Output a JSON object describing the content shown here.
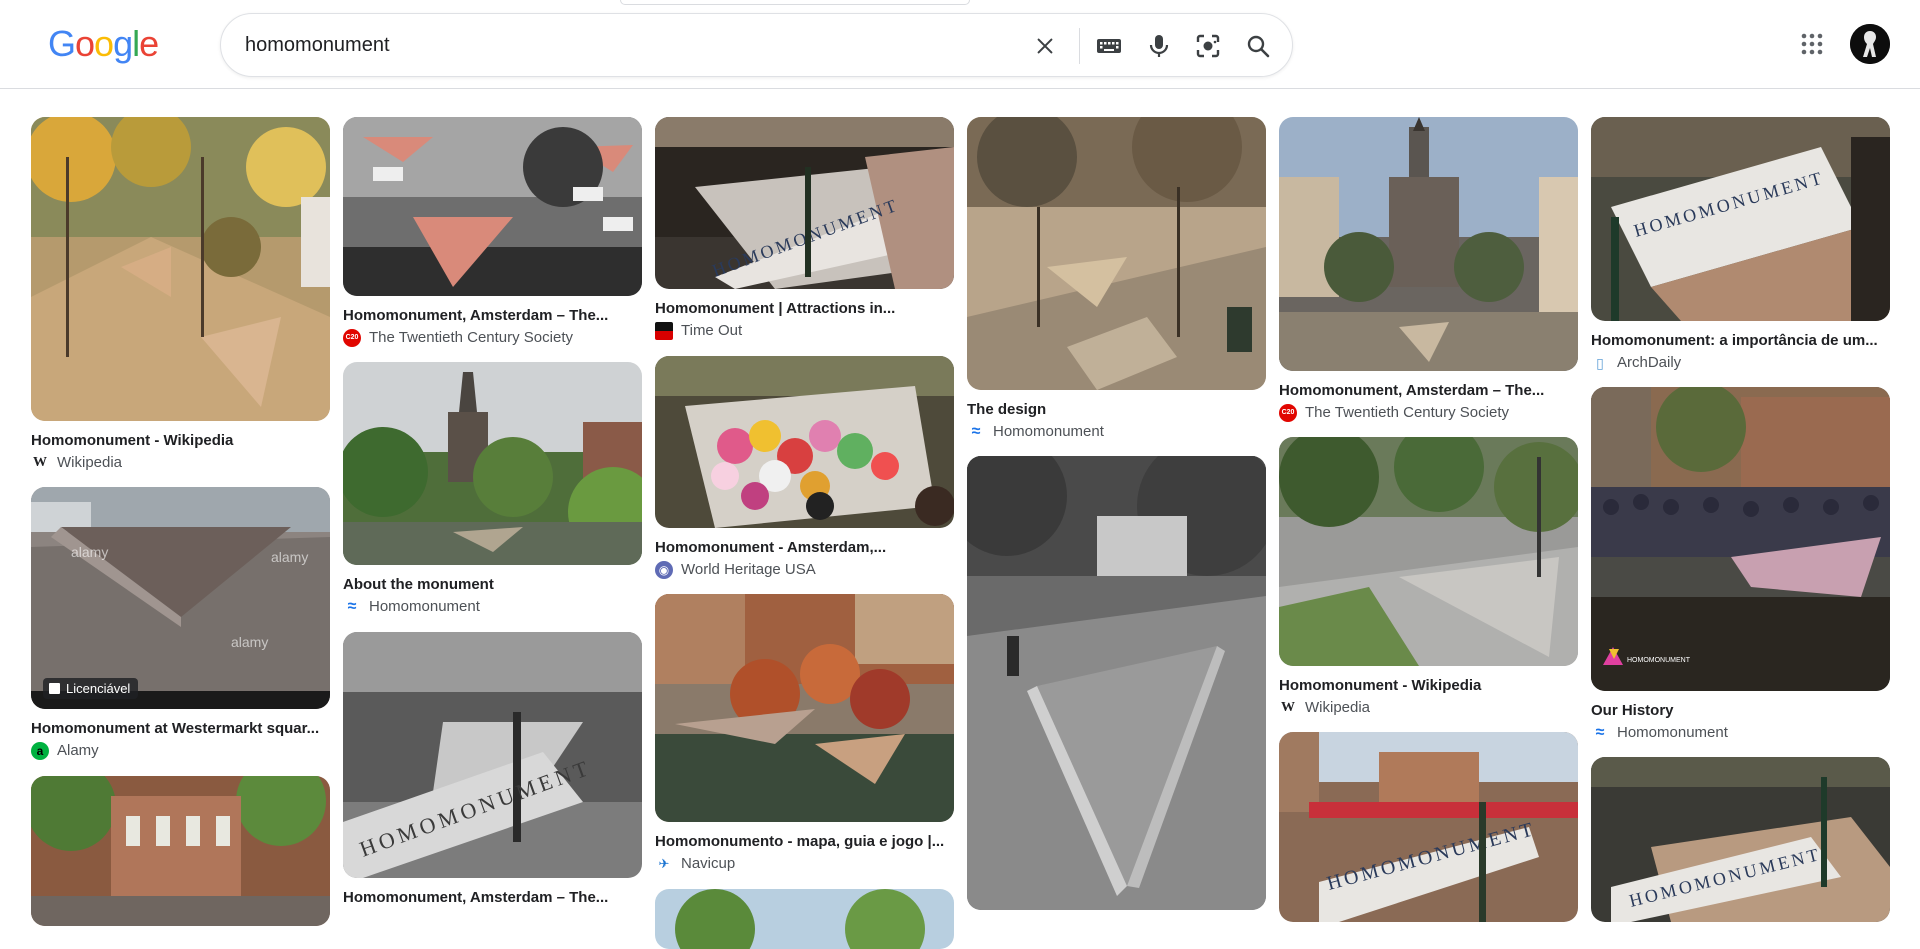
{
  "header": {
    "logo_letters": [
      {
        "ch": "G",
        "color": "#4285F4"
      },
      {
        "ch": "o",
        "color": "#EA4335"
      },
      {
        "ch": "o",
        "color": "#FBBC05"
      },
      {
        "ch": "g",
        "color": "#4285F4"
      },
      {
        "ch": "l",
        "color": "#34A853"
      },
      {
        "ch": "e",
        "color": "#EA4335"
      }
    ],
    "search_value": "homomonument",
    "icons": [
      "close-icon",
      "keyboard-icon",
      "microphone-icon",
      "lens-icon",
      "search-icon"
    ],
    "apps_icon": "apps-grid-icon",
    "avatar_icon": "account-avatar"
  },
  "results": {
    "col1": [
      {
        "title": "Homomonument - Wikipedia",
        "source": "Wikipedia",
        "fav": "W",
        "fav_color": "#ffffff",
        "fav_text": "#202124"
      },
      {
        "title": "Homomonument at Westermarkt squar...",
        "source": "Alamy",
        "fav": "a",
        "fav_color": "#00b140",
        "fav_text": "#000000",
        "badge": "Licenciável"
      },
      {
        "title": "",
        "source": ""
      }
    ],
    "col2": [
      {
        "title": "Homomonument, Amsterdam – The...",
        "source": "The Twentieth Century Society",
        "fav": "C20",
        "fav_color": "#e10600",
        "fav_text": "#ffffff"
      },
      {
        "title": "About the monument",
        "source": "Homomonument",
        "fav": "≈",
        "fav_color": "#ffffff",
        "fav_text": "#1a73e8"
      },
      {
        "title": "Homomonument, Amsterdam – The...",
        "source": "",
        "fav": "",
        "fav_color": "",
        "fav_text": ""
      }
    ],
    "col3": [
      {
        "title": "Homomonument | Attractions in...",
        "source": "Time Out",
        "fav": "",
        "fav_color": "#d80000",
        "fav_text": "#ffffff"
      },
      {
        "title": "Homomonument - Amsterdam,...",
        "source": "World Heritage USA",
        "fav": "◉",
        "fav_color": "#5f6bb5",
        "fav_text": "#ffffff"
      },
      {
        "title": "Homomonumento - mapa, guia e jogo |...",
        "source": "Navicup",
        "fav": "✈",
        "fav_color": "#ffffff",
        "fav_text": "#1b74d1"
      }
    ],
    "col4": [
      {
        "title": "The design",
        "source": "Homomonument",
        "fav": "≈",
        "fav_color": "#ffffff",
        "fav_text": "#1a73e8"
      },
      {
        "title": "",
        "source": ""
      }
    ],
    "col5": [
      {
        "title": "Homomonument, Amsterdam – The...",
        "source": "The Twentieth Century Society",
        "fav": "C20",
        "fav_color": "#e10600",
        "fav_text": "#ffffff"
      },
      {
        "title": "Homomonument - Wikipedia",
        "source": "Wikipedia",
        "fav": "W",
        "fav_color": "#ffffff",
        "fav_text": "#202124"
      },
      {
        "title": "",
        "source": ""
      }
    ],
    "col6": [
      {
        "title": "Homomonument: a importância de um...",
        "source": "ArchDaily",
        "fav": "▯",
        "fav_color": "#ffffff",
        "fav_text": "#5f9fd6"
      },
      {
        "title": "Our History",
        "source": "Homomonument",
        "fav": "≈",
        "fav_color": "#ffffff",
        "fav_text": "#1a73e8"
      },
      {
        "title": "",
        "source": ""
      }
    ],
    "image_text": {
      "sign": "HOMOMONUMENT",
      "watermark": "alamy",
      "logo_small": "HOMOMONUMENT"
    }
  }
}
